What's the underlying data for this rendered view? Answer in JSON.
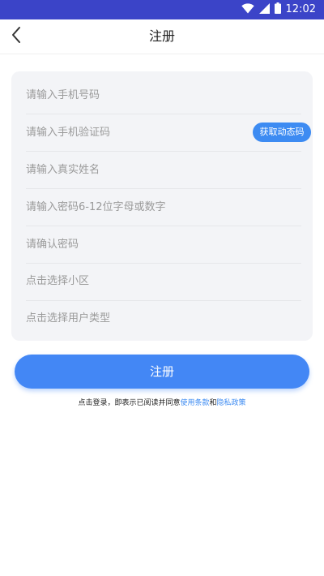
{
  "status_bar": {
    "time": "12:02",
    "icons": [
      "wifi-icon",
      "cellular-signal-icon",
      "battery-icon"
    ]
  },
  "header": {
    "title": "注册",
    "back_icon": "chevron-left-icon"
  },
  "form": {
    "phone": {
      "placeholder": "请输入手机号码",
      "value": ""
    },
    "sms_code": {
      "placeholder": "请输入手机验证码",
      "value": "",
      "send_button_label": "获取动态码"
    },
    "real_name": {
      "placeholder": "请输入真实姓名",
      "value": ""
    },
    "password": {
      "placeholder": "请输入密码6-12位字母或数字",
      "value": ""
    },
    "confirm_password": {
      "placeholder": "请确认密码",
      "value": ""
    },
    "community_select": {
      "label": "点击选择小区"
    },
    "user_type_select": {
      "label": "点击选择用户类型"
    }
  },
  "submit": {
    "label": "注册"
  },
  "agreement": {
    "prefix": "点击登录，即表示已阅读并同意",
    "terms_link": "使用条款",
    "and": "和",
    "privacy_link": "隐私政策"
  },
  "colors": {
    "status_bar": "#3b44c8",
    "primary": "#4387f5",
    "link": "#3d8bf2",
    "card_bg": "#f3f4f7",
    "placeholder": "#9a9a9a"
  }
}
